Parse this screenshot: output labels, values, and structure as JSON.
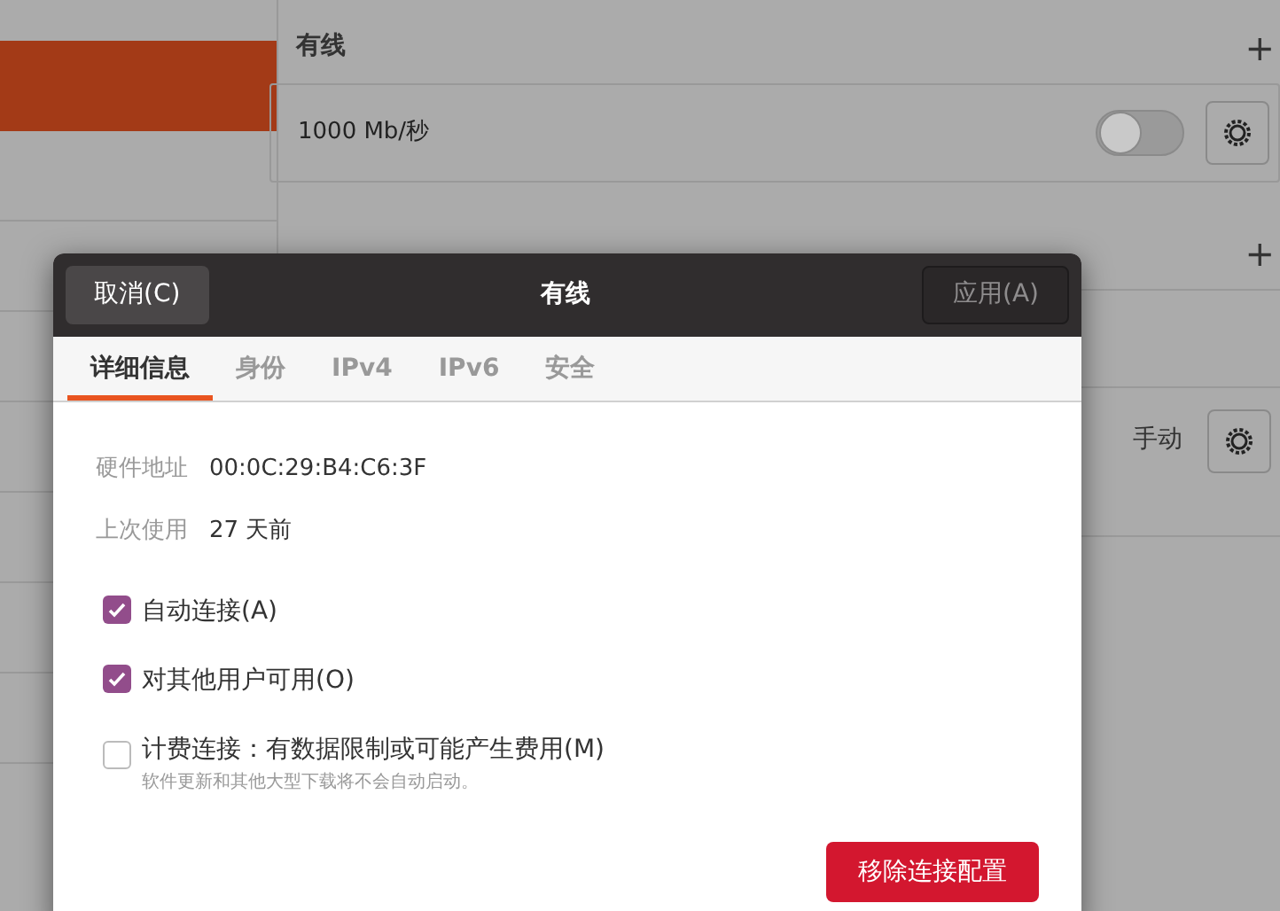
{
  "background": {
    "sidebar": {
      "items": [
        {
          "selected": true
        },
        {
          "selected": false
        },
        {
          "selected": false
        },
        {
          "selected": false
        },
        {
          "selected": false
        },
        {
          "selected": false
        },
        {
          "selected": false
        },
        {
          "selected": false
        }
      ]
    },
    "wired": {
      "heading": "有线",
      "add": "+",
      "connection": {
        "speed": "1000 Mb/秒",
        "on": false
      }
    },
    "vpn": {
      "add": "+",
      "connection": {
        "mode": "手动"
      }
    }
  },
  "dialog": {
    "title": "有线",
    "cancel": "取消(C)",
    "apply": "应用(A)",
    "tabs": [
      {
        "label": "详细信息",
        "selected": true
      },
      {
        "label": "身份",
        "selected": false
      },
      {
        "label": "IPv4",
        "selected": false
      },
      {
        "label": "IPv6",
        "selected": false
      },
      {
        "label": "安全",
        "selected": false
      }
    ],
    "details": [
      {
        "label": "硬件地址",
        "value": "00:0C:29:B4:C6:3F"
      },
      {
        "label": "上次使用",
        "value": "27 天前"
      }
    ],
    "options": [
      {
        "label": "自动连接(A)",
        "checked": true
      },
      {
        "label": "对其他用户可用(O)",
        "checked": true
      },
      {
        "label": "计费连接：有数据限制或可能产生费用(M)",
        "hint": "软件更新和其他大型下载将不会自动启动。",
        "checked": false
      }
    ],
    "remove": "移除连接配置"
  }
}
